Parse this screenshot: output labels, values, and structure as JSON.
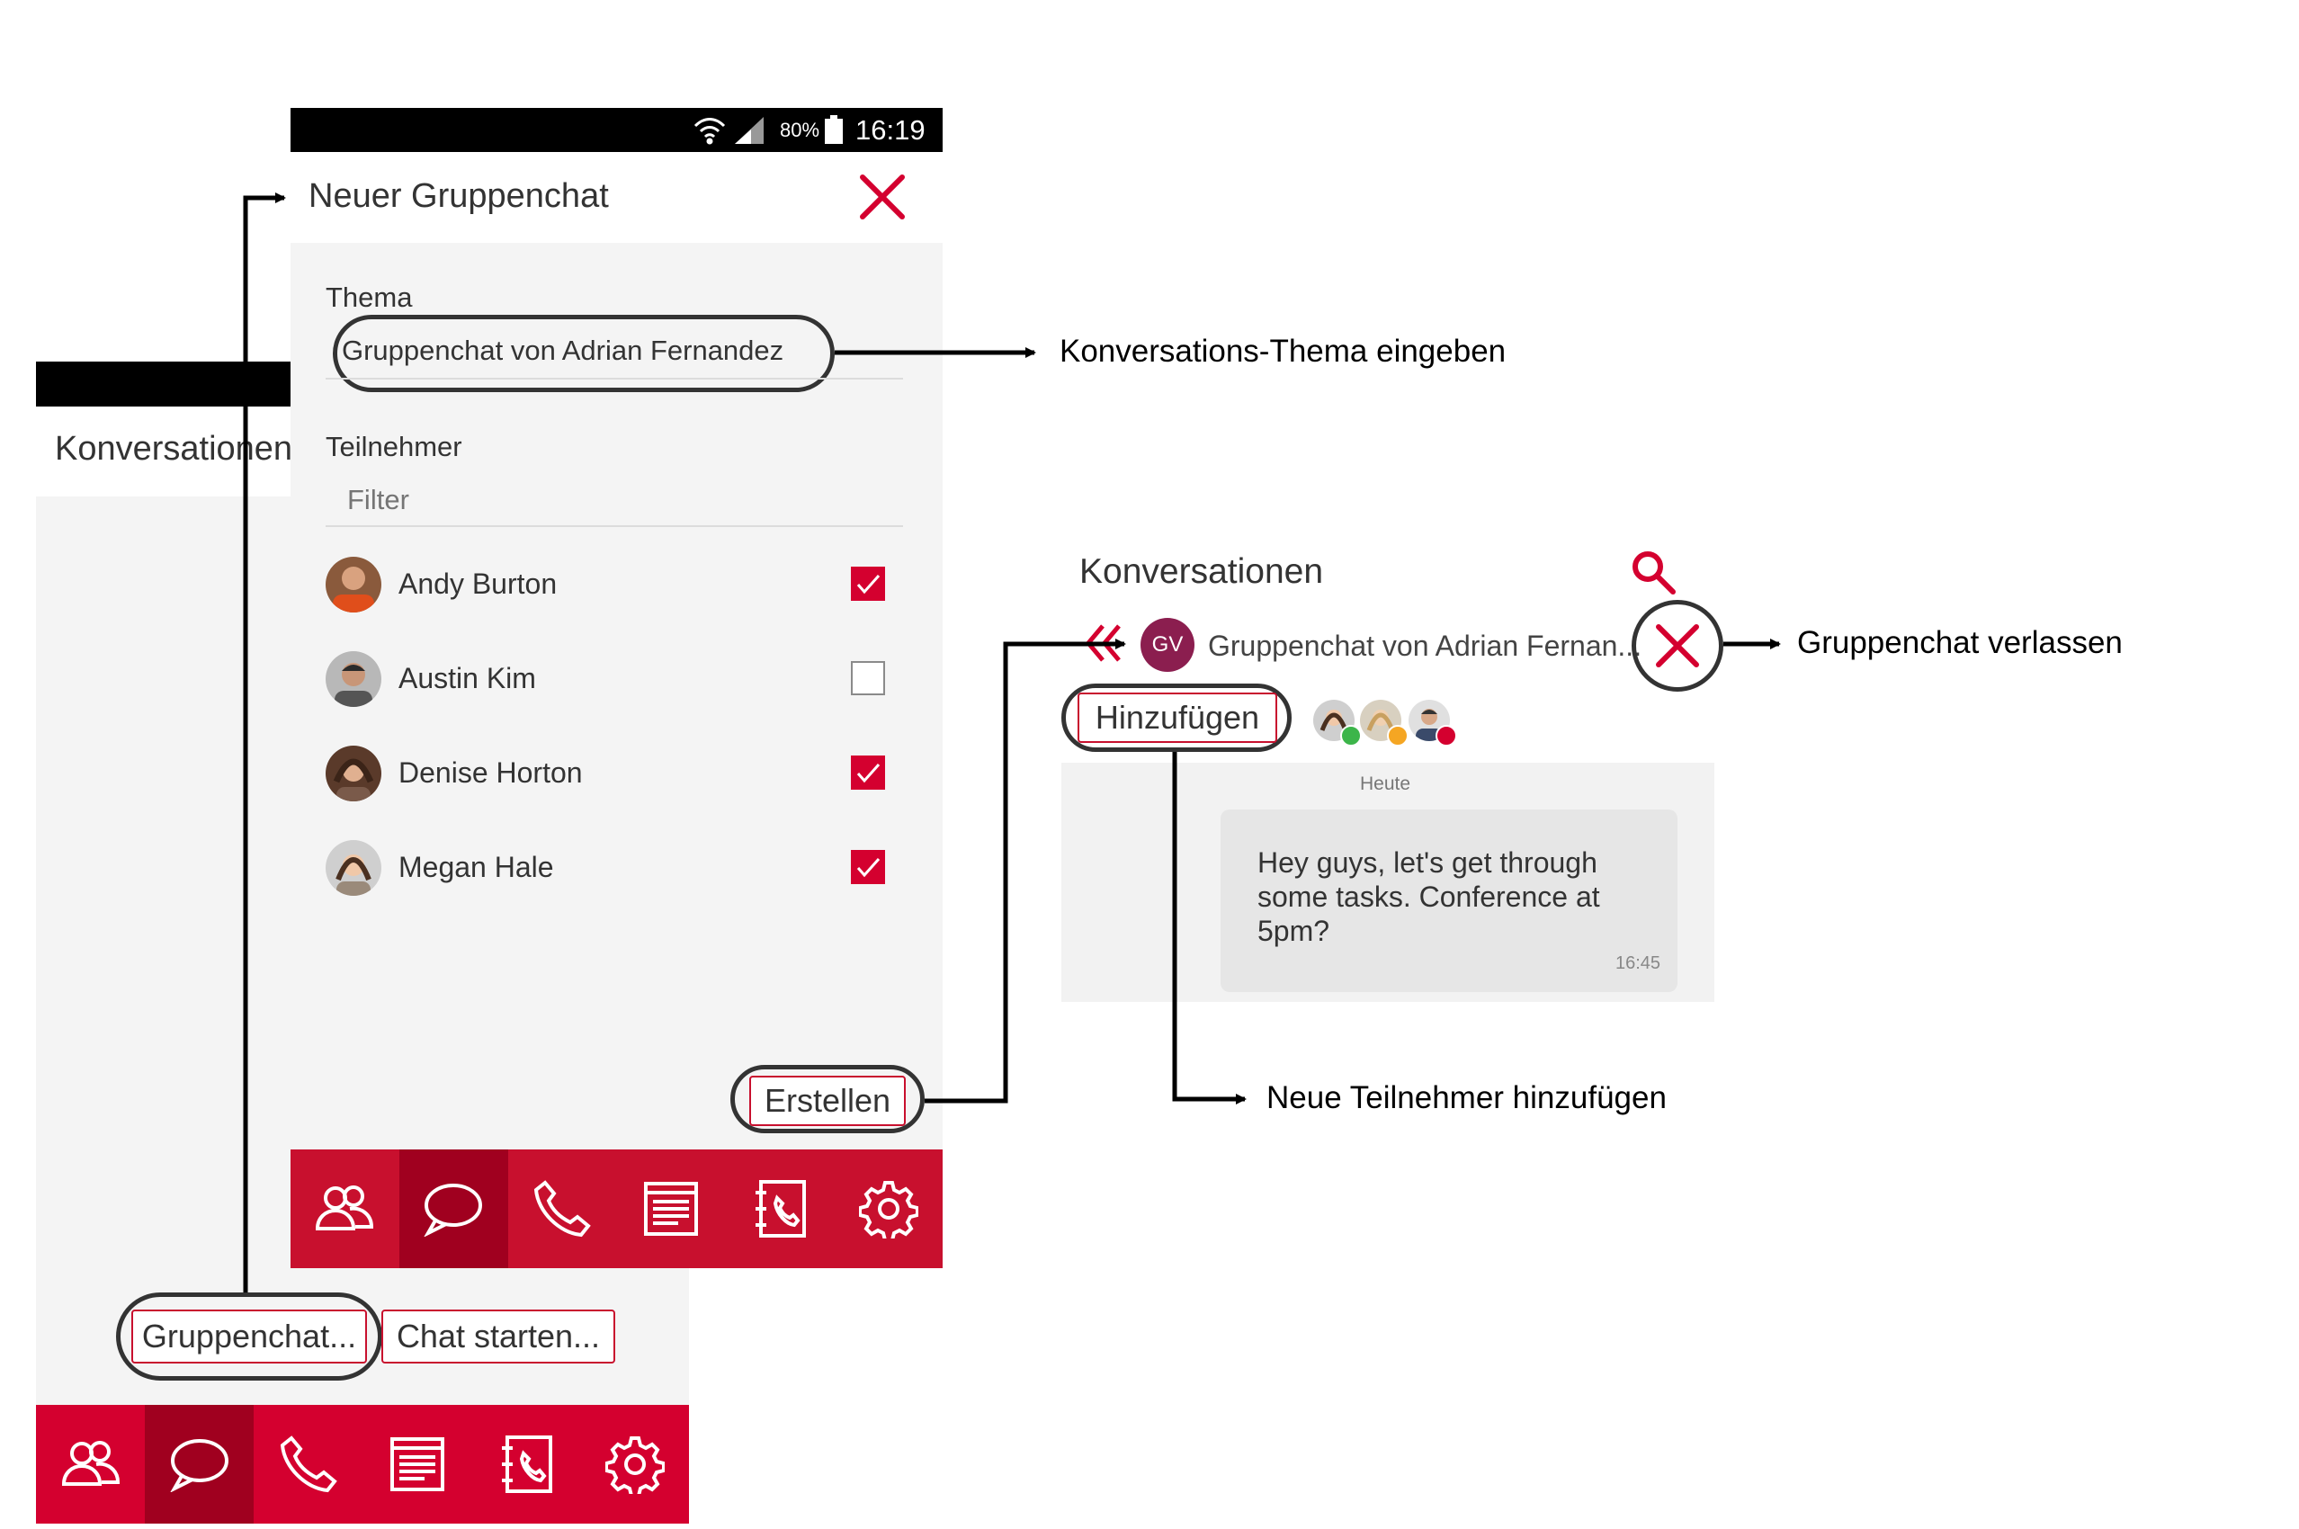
{
  "back_screen": {
    "title": "Konversationen",
    "buttons": {
      "group": "Gruppenchat...",
      "start": "Chat starten..."
    },
    "nav": [
      "people-icon",
      "chat-bubble-icon",
      "phone-icon",
      "document-icon",
      "contacts-book-icon",
      "gear-icon"
    ]
  },
  "front_screen": {
    "status": {
      "battery": "80%",
      "time": "16:19"
    },
    "title": "Neuer Gruppenchat",
    "topic_label": "Thema",
    "topic_value": "Gruppenchat von Adrian Fernandez",
    "participants_label": "Teilnehmer",
    "filter_placeholder": "Filter",
    "contacts": [
      {
        "name": "Andy Burton",
        "checked": true
      },
      {
        "name": "Austin Kim",
        "checked": false
      },
      {
        "name": "Denise Horton",
        "checked": true
      },
      {
        "name": "Megan Hale",
        "checked": true
      }
    ],
    "create_button": "Erstellen",
    "nav": [
      "people-icon",
      "chat-bubble-icon",
      "phone-icon",
      "document-icon",
      "contacts-book-icon",
      "gear-icon"
    ]
  },
  "conversation_panel": {
    "title": "Konversationen",
    "avatar_initials": "GV",
    "chat_name": "Gruppenchat von Adrian Fernan...",
    "add_button": "Hinzufügen",
    "participant_status_colors": [
      "#3cb54a",
      "#f5a623",
      "#d4002f"
    ],
    "day_label": "Heute",
    "message": "Hey guys, let's get through some tasks. Conference at 5pm?",
    "message_time": "16:45"
  },
  "annotations": {
    "topic": "Konversations-Thema eingeben",
    "leave": "Gruppenchat verlassen",
    "add": "Neue Teilnehmer hinzufügen"
  },
  "colors": {
    "brand_red": "#c8102e",
    "active_nav": "#a0001f",
    "gv_avatar": "#8b1e4f"
  }
}
